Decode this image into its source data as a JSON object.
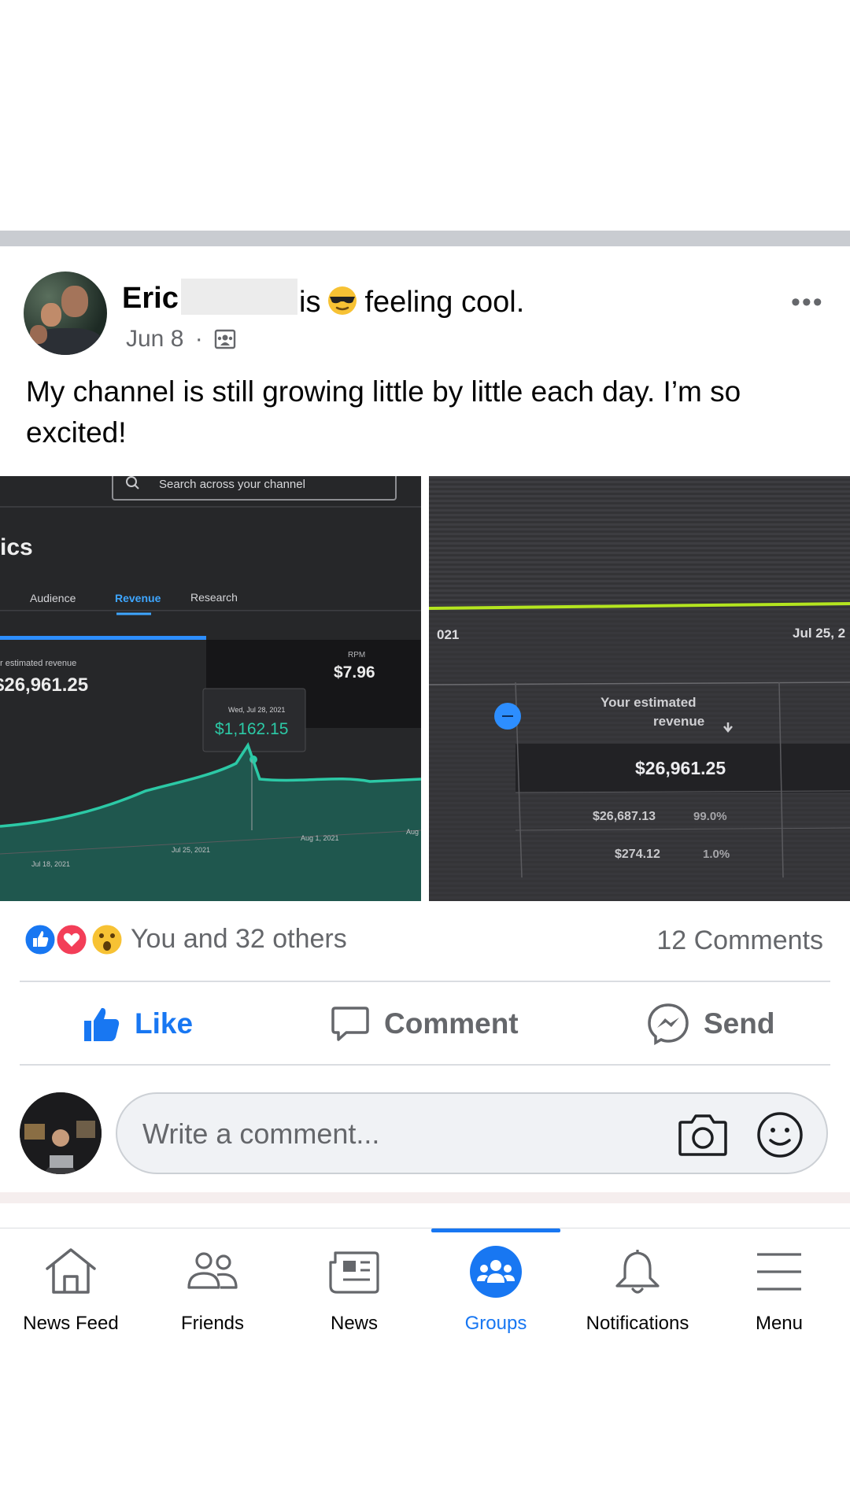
{
  "post": {
    "author_name": "Eric",
    "feeling_prefix": "is",
    "feeling_text": "feeling cool.",
    "date": "Jun 8",
    "separator": "·",
    "more_label": "•••",
    "text": "My channel is still growing little by little each day. I’m so excited!"
  },
  "photo1": {
    "search_placeholder": "Search across your channel",
    "section_title": "ics",
    "tabs": [
      "Audience",
      "Revenue",
      "Research"
    ],
    "revenue_label": "r estimated revenue",
    "revenue_value": "$26,961.25",
    "rpm_label": "RPM",
    "rpm_value": "$7.96",
    "tooltip_date": "Wed, Jul 28, 2021",
    "tooltip_value": "$1,162.15",
    "x_ticks": [
      "Jul 18, 2021",
      "Jul 25, 2021",
      "Aug 1, 2021",
      "Aug"
    ]
  },
  "photo2": {
    "top_left": "021",
    "top_right": "Jul 25, 2",
    "header_line1": "Your estimated",
    "header_line2": "revenue",
    "total": "$26,961.25",
    "row1_value": "$26,687.13",
    "row1_pct": "99.0%",
    "row2_value": "$274.12",
    "row2_pct": "1.0%"
  },
  "engagement": {
    "reactions_text": "You and 32 others",
    "comments_count": "12 Comments"
  },
  "actions": {
    "like": "Like",
    "comment": "Comment",
    "send": "Send"
  },
  "comment_input": {
    "placeholder": "Write a comment..."
  },
  "tabs": [
    {
      "label": "News Feed",
      "icon": "home-icon"
    },
    {
      "label": "Friends",
      "icon": "friends-icon"
    },
    {
      "label": "News",
      "icon": "news-icon"
    },
    {
      "label": "Groups",
      "icon": "groups-icon",
      "active": true
    },
    {
      "label": "Notifications",
      "icon": "bell-icon"
    },
    {
      "label": "Menu",
      "icon": "menu-icon"
    }
  ],
  "colors": {
    "brand_blue": "#1877f2",
    "muted_text": "#65676b",
    "chart_teal": "#27a58b"
  }
}
